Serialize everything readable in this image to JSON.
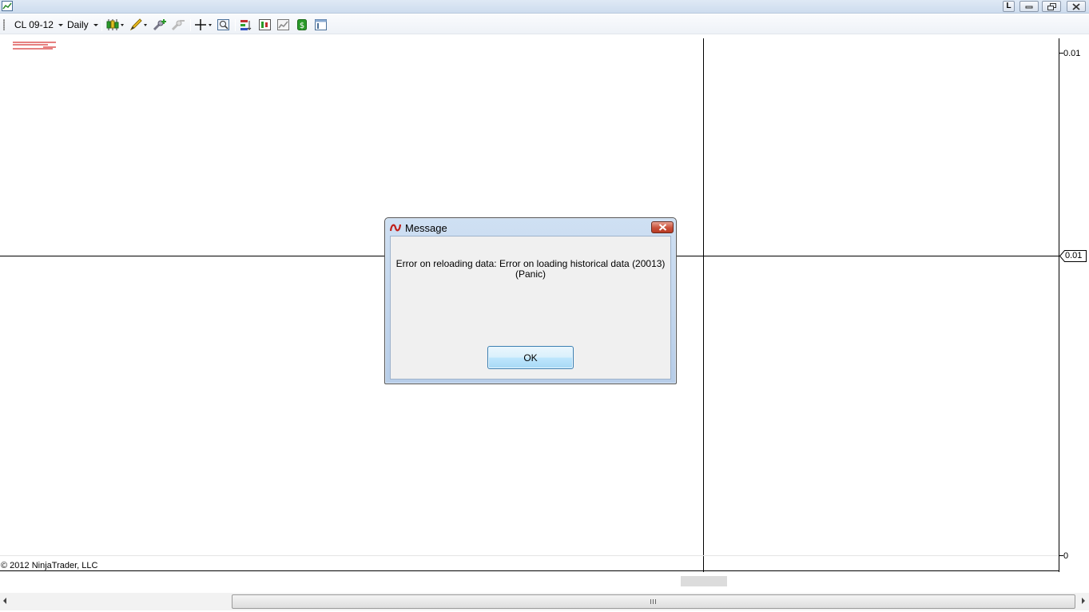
{
  "window": {
    "app_icon": "chart-window-icon",
    "controls": [
      "link-button",
      "minimize-button",
      "restore-button",
      "close-button"
    ],
    "link_label": "L"
  },
  "toolbar": {
    "instrument": "CL 09-12",
    "period": "Daily",
    "icons": [
      "chart-style-icon",
      "drawing-tool-icon",
      "zoom-in-icon",
      "zoom-out-icon",
      "crosshair-icon",
      "data-box-icon",
      "indicators-icon",
      "strategies-icon",
      "chart-properties-icon",
      "order-entry-icon",
      "templates-icon"
    ]
  },
  "chart": {
    "y_axis_labels": {
      "top": "0.01",
      "bottom": "0"
    },
    "price_marker": "0.01",
    "copyright": "© 2012 NinjaTrader, LLC",
    "line_color": "#000000",
    "legend_color": "#cc0000"
  },
  "dialog": {
    "title": "Message",
    "message_line1": "Error on reloading data: Error on loading historical data (20013)",
    "message_line2": "(Panic)",
    "ok_label": "OK"
  }
}
